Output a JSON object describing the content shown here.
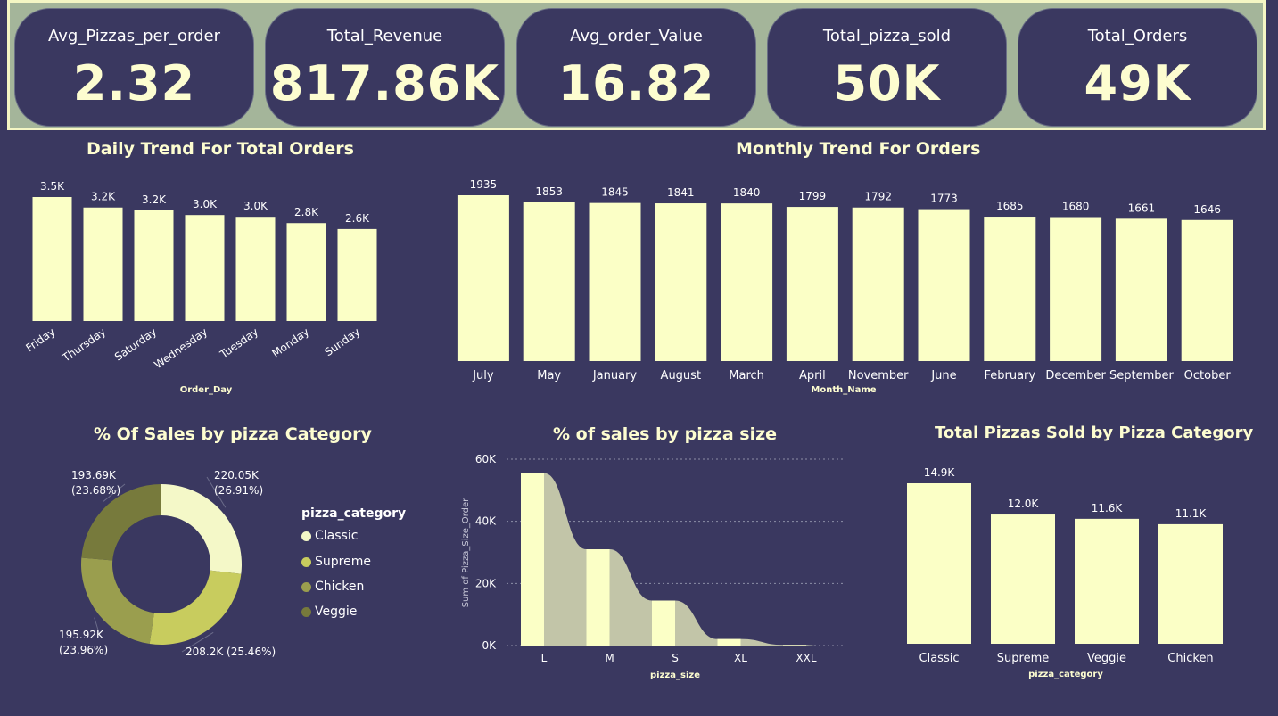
{
  "kpis": [
    {
      "label": "Avg_Pizzas_per_order",
      "value": "2.32"
    },
    {
      "label": "Total_Revenue",
      "value": "817.86K"
    },
    {
      "label": "Avg_order_Value",
      "value": "16.82"
    },
    {
      "label": "Total_pizza_sold",
      "value": "50K"
    },
    {
      "label": "Total_Orders",
      "value": "49K"
    }
  ],
  "colors": {
    "background": "#3a3860",
    "kpi_band": "#a4b59a",
    "bar": "#fbffc6",
    "text": "#fdfdd0",
    "area": "#c2c5a8",
    "classic": "#f4f8c8",
    "supreme": "#c8cc5e",
    "chicken": "#9a9e4e",
    "veggie": "#777a3c"
  },
  "chart_data": [
    {
      "type": "bar",
      "title": "Daily Trend For Total Orders",
      "xlabel": "Order_Day",
      "ylabel": "",
      "categories": [
        "Friday",
        "Thursday",
        "Saturday",
        "Wednesday",
        "Tuesday",
        "Monday",
        "Sunday"
      ],
      "values": [
        3538,
        3239,
        3158,
        3024,
        2973,
        2794,
        2624
      ],
      "data_labels": [
        "3.5K",
        "3.2K",
        "3.2K",
        "3.0K",
        "3.0K",
        "2.8K",
        "2.6K"
      ],
      "ylim": [
        0,
        3538
      ]
    },
    {
      "type": "bar",
      "title": "Monthly Trend For Orders",
      "xlabel": "Month_Name",
      "ylabel": "",
      "categories": [
        "July",
        "May",
        "January",
        "August",
        "March",
        "April",
        "November",
        "June",
        "February",
        "December",
        "September",
        "October"
      ],
      "values": [
        1935,
        1853,
        1845,
        1841,
        1840,
        1799,
        1792,
        1773,
        1685,
        1680,
        1661,
        1646
      ],
      "data_labels": [
        "1935",
        "1853",
        "1845",
        "1841",
        "1840",
        "1799",
        "1792",
        "1773",
        "1685",
        "1680",
        "1661",
        "1646"
      ],
      "ylim": [
        0,
        1935
      ]
    },
    {
      "type": "pie",
      "title": "% Of Sales by pizza Category",
      "legend_title": "pizza_category",
      "legend_position": "right",
      "donut": true,
      "categories": [
        "Classic",
        "Supreme",
        "Chicken",
        "Veggie"
      ],
      "values": [
        220050,
        208200,
        195920,
        193690
      ],
      "value_labels": [
        "220.05K",
        "208.2K (25.46%)",
        "195.92K",
        "193.69K"
      ],
      "percent_labels": [
        "(26.91%)",
        "",
        "(23.96%)",
        "(23.68%)"
      ]
    },
    {
      "type": "area",
      "title": "% of sales by pizza size",
      "xlabel": "pizza_size",
      "ylabel": "Sum of Pizza_Size_Order",
      "categories": [
        "L",
        "M",
        "S",
        "XL",
        "XXL"
      ],
      "values": [
        55500,
        31000,
        14500,
        2100,
        200
      ],
      "yticks": [
        "0K",
        "20K",
        "40K",
        "60K"
      ],
      "ylim": [
        0,
        60000
      ],
      "grid": true
    },
    {
      "type": "bar",
      "title": "Total Pizzas Sold by Pizza Category",
      "xlabel": "pizza_category",
      "ylabel": "",
      "categories": [
        "Classic",
        "Supreme",
        "Veggie",
        "Chicken"
      ],
      "values": [
        14900,
        12000,
        11600,
        11100
      ],
      "data_labels": [
        "14.9K",
        "12.0K",
        "11.6K",
        "11.1K"
      ],
      "ylim": [
        0,
        14900
      ]
    }
  ]
}
